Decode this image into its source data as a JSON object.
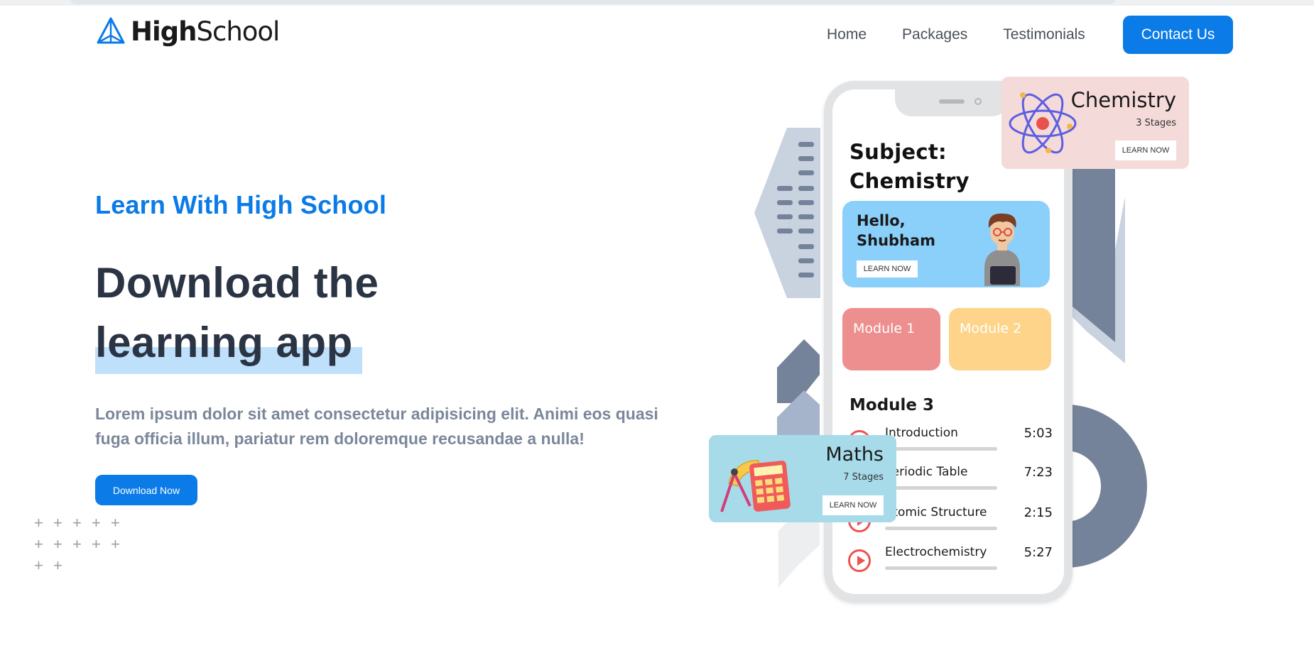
{
  "brand": {
    "name_part1": "High",
    "name_part2": "School",
    "logo_icon": "pyramid-logo-icon"
  },
  "nav": {
    "links": [
      "Home",
      "Packages",
      "Testimonials"
    ],
    "cta": "Contact Us"
  },
  "hero": {
    "eyebrow": "Learn With High School",
    "title_line1": "Download the",
    "title_line2": "learning app",
    "description": "Lorem ipsum dolor sit amet consectetur adipisicing elit. Animi eos quasi fuga officia illum, pariatur rem doloremque recusandae a nulla!",
    "button": "Download Now"
  },
  "phone": {
    "subject_title_line1": "Subject:",
    "subject_title_line2": "Chemistry",
    "greeting_line1": "Hello,",
    "greeting_line2": "Shubham",
    "greeting_button": "LEARN NOW",
    "modules": [
      "Module 1",
      "Module 2"
    ],
    "module3_title": "Module 3",
    "lessons": [
      {
        "name": "Introduction",
        "time": "5:03"
      },
      {
        "name": "Periodic Table",
        "time": "7:23"
      },
      {
        "name": "Atomic Structure",
        "time": "2:15"
      },
      {
        "name": "Electrochemistry",
        "time": "5:27"
      }
    ]
  },
  "cards": {
    "chemistry": {
      "title": "Chemistry",
      "stages": "3 Stages",
      "button": "LEARN NOW"
    },
    "maths": {
      "title": "Maths",
      "stages": "7 Stages",
      "button": "LEARN NOW"
    }
  },
  "colors": {
    "primary": "#0b7be7",
    "heading": "#2b3444",
    "muted": "#7b879a",
    "highlight": "#bfe0fb",
    "slate": "#75839a",
    "light_slate": "#c9d2df",
    "module1": "#ed8f8e",
    "module2": "#fdd48a",
    "hello_card": "#8bd0fb",
    "chem_card": "#f5dada",
    "math_card": "#a7dbea"
  }
}
